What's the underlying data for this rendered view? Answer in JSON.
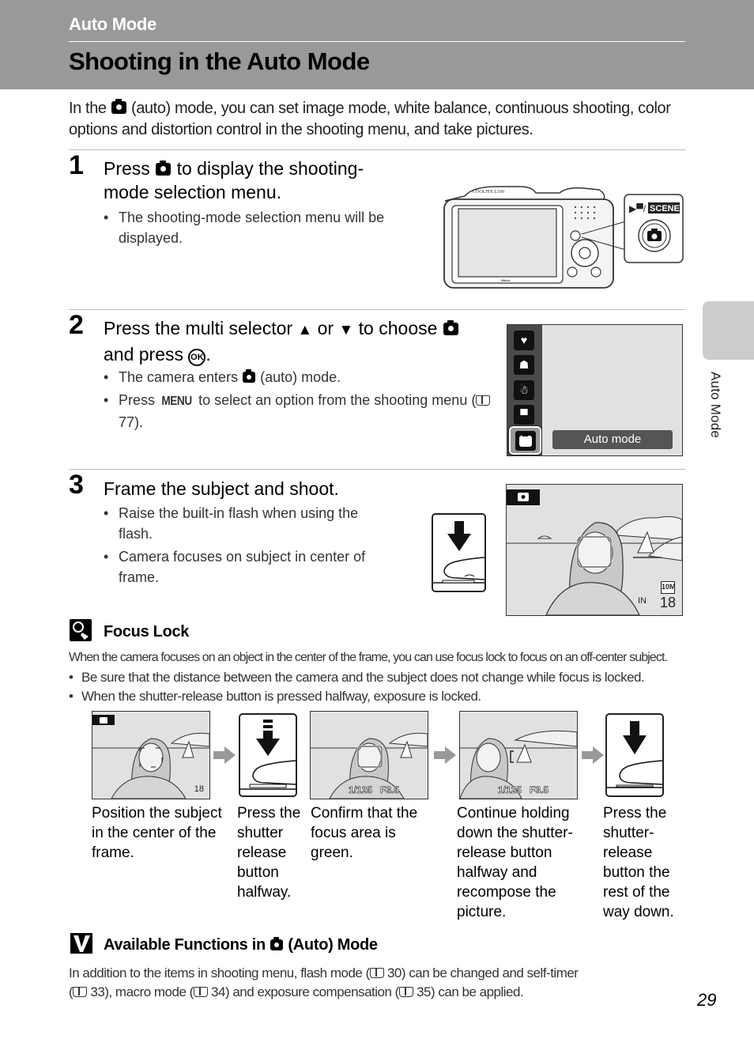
{
  "header": {
    "section": "Auto Mode",
    "title": "Shooting in the Auto Mode"
  },
  "intro": {
    "before_icon": "In the ",
    "icon": "auto-camera-icon",
    "after_icon": " (auto) mode, you can set image mode, white balance, continuous shooting, color options and distortion control in the shooting menu, and take pictures."
  },
  "steps": [
    {
      "number": "1",
      "title_before": "Press ",
      "title_after": " to display the shooting-mode selection menu.",
      "bullets": [
        "The shooting-mode selection menu will be displayed."
      ],
      "figure": {
        "camera_model": "COOLPIX L100",
        "brand": "Nikon",
        "callout_label": "/ SCENE",
        "callout_scene": "SCENE"
      }
    },
    {
      "number": "2",
      "title_part1": "Press the multi selector ",
      "up": "▲",
      "or": " or ",
      "down": "▼",
      "title_part2": " to choose ",
      "title_part3": " and press ",
      "ok": "OK",
      "title_part4": ".",
      "bullets": [
        {
          "before": "The camera enters ",
          "after": " (auto) mode."
        },
        {
          "before": "Press ",
          "menu": "MENU",
          "middle": " to select an option from the shooting menu (",
          "page": "77",
          "after": ")."
        }
      ],
      "figure": {
        "menu_icons": [
          "smart-portrait-icon",
          "scene-icon",
          "sport-continuous-icon",
          "movie-icon",
          "auto-camera-icon"
        ],
        "selected_label": "Auto mode"
      }
    },
    {
      "number": "3",
      "title": "Frame the subject and shoot.",
      "bullets": [
        "Raise the built-in flash when using the flash.",
        "Camera focuses on subject in center of frame."
      ],
      "figure": {
        "image_mode": "10M",
        "memory": "IN",
        "exposures_remaining": "18"
      }
    }
  ],
  "focus_lock": {
    "title": "Focus Lock",
    "intro": "When the camera focuses on an object in the center of the frame, you can use focus lock to focus on an off-center subject.",
    "bullets": [
      "Be sure that the distance between the camera and the subject does not change while focus is locked.",
      "When the shutter-release button is pressed halfway, exposure is locked."
    ],
    "sequence": [
      {
        "caption": "Position the subject in the center of the frame.",
        "readout": "18"
      },
      {
        "caption": "Press the shutter release button halfway."
      },
      {
        "caption": "Confirm that the focus area is green.",
        "shutter": "1/125",
        "aperture": "F3.5"
      },
      {
        "caption": "Continue holding down the shutter-release button halfway and recompose the picture.",
        "shutter": "1/125",
        "aperture": "F3.5"
      },
      {
        "caption": "Press the shutter-release button the rest of the way down."
      }
    ]
  },
  "available": {
    "title_before": "Available Functions in ",
    "title_after": " (Auto) Mode",
    "text_1": "In addition to the items in shooting menu, flash mode (",
    "p1": "30",
    "text_2": ") can be changed and self-timer",
    "text_3": "(",
    "p2": "33",
    "text_4": "), macro mode (",
    "p3": "34",
    "text_5": ") and exposure compensation (",
    "p4": "35",
    "text_6": ") can be applied."
  },
  "side_tab": "Auto Mode",
  "page_number": "29"
}
